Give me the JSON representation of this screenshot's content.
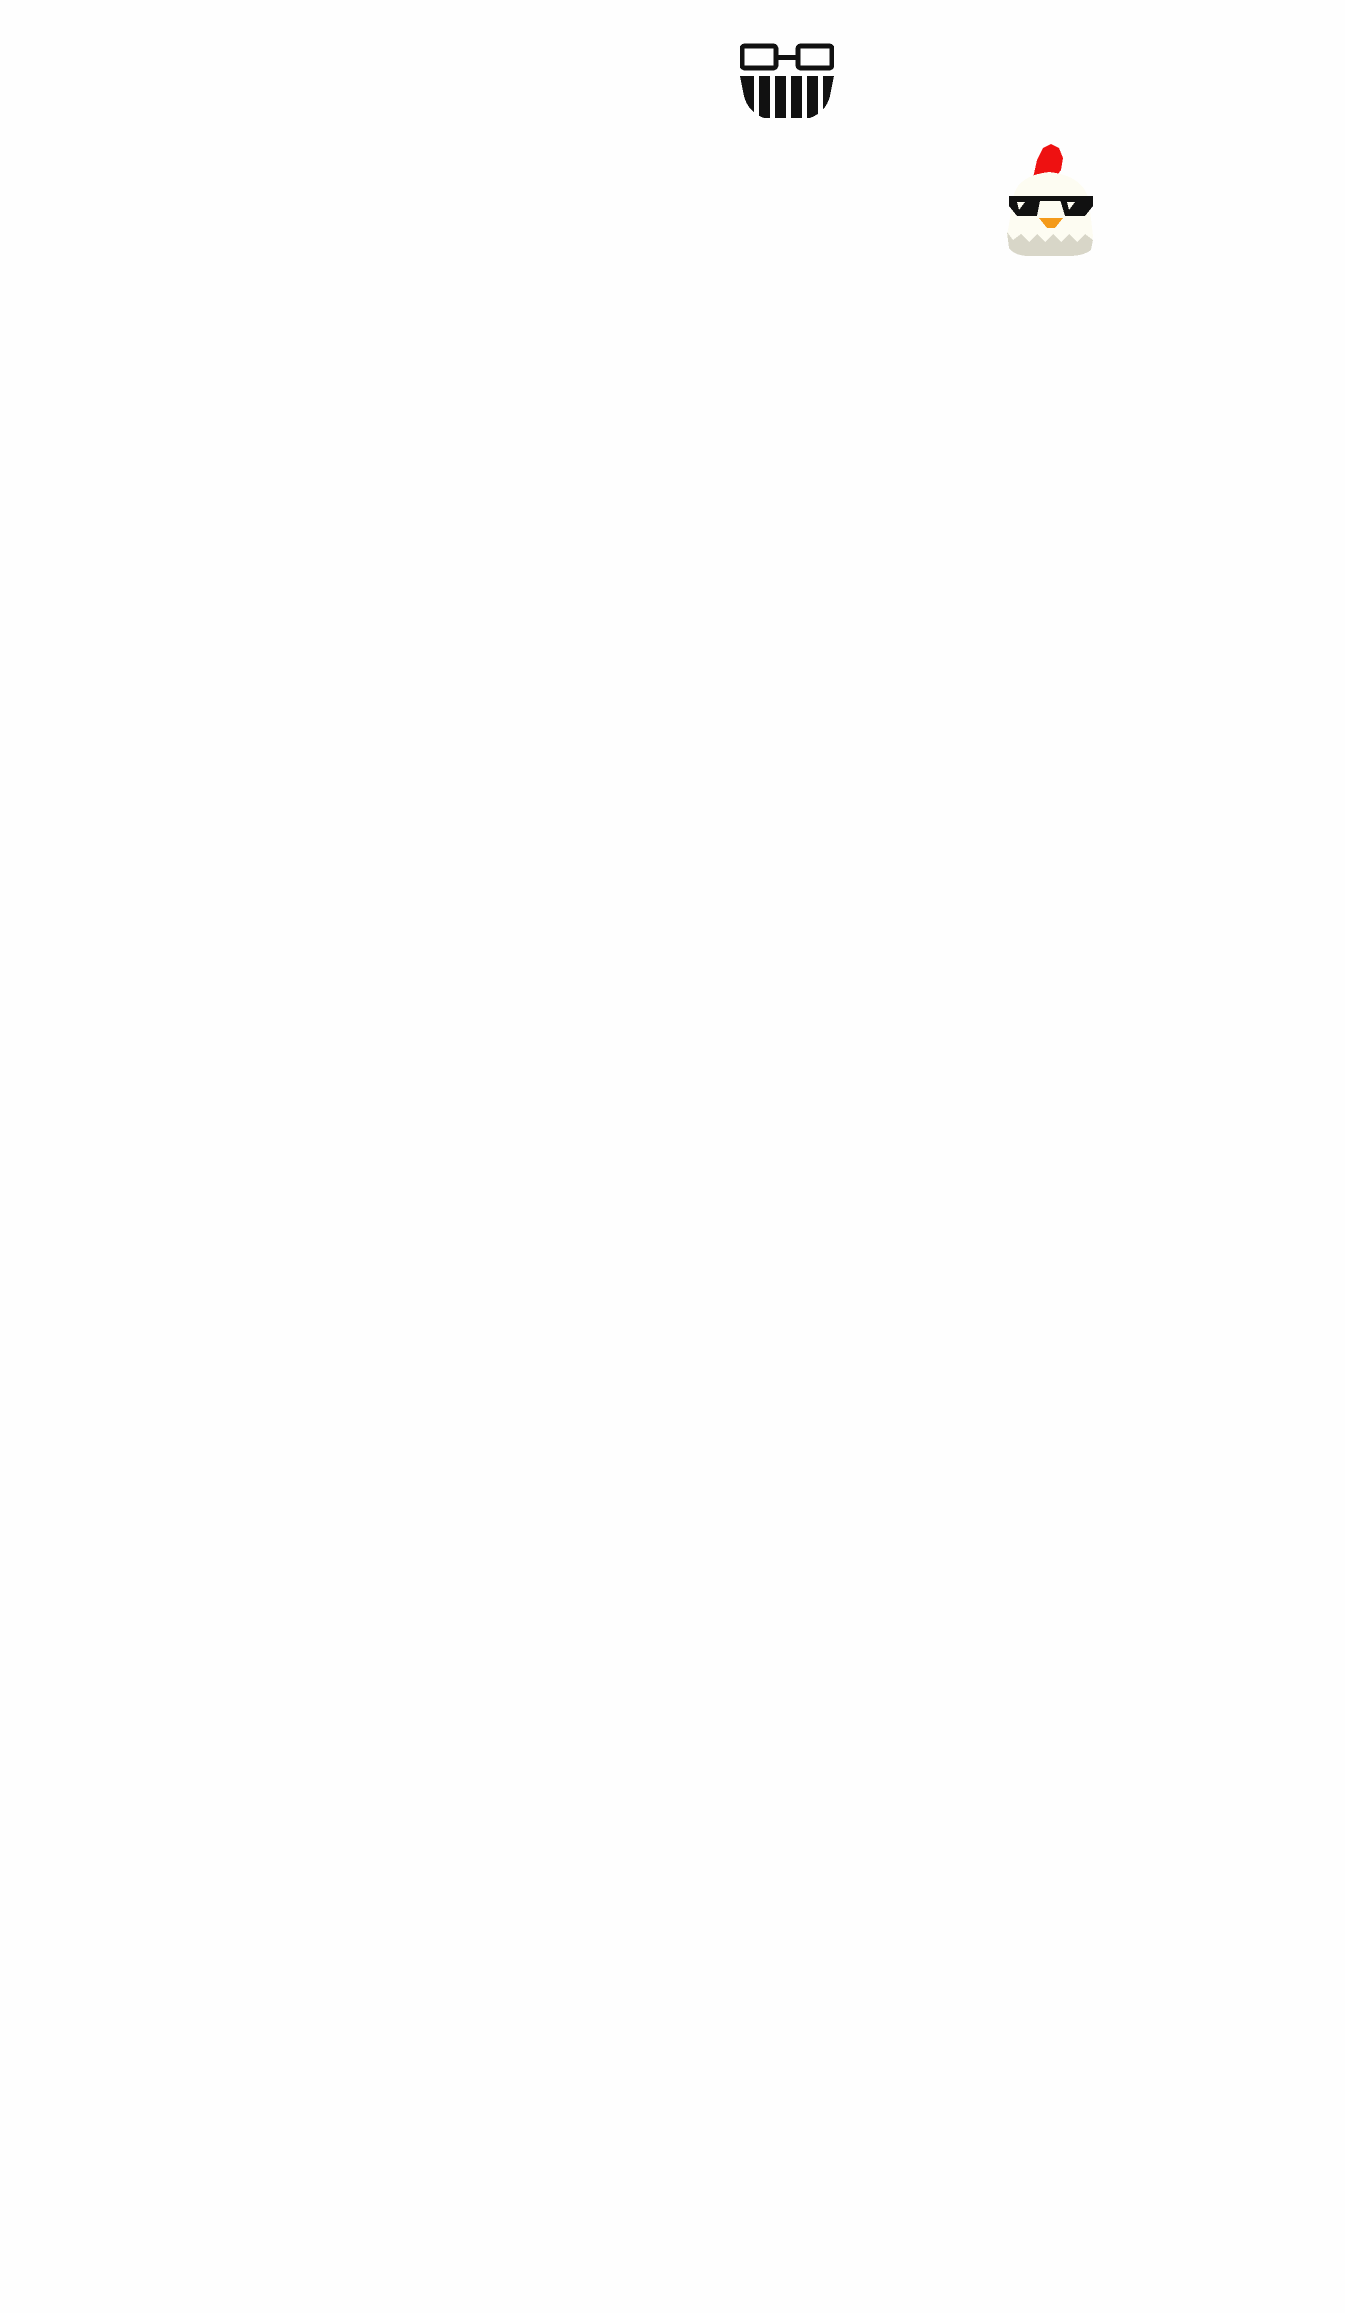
{
  "header": {
    "logo_icon": "glasses-barcode-logo-icon"
  },
  "mascot": {
    "icon": "chicken-with-sunglasses-icon",
    "colors": {
      "comb": "#ee1111",
      "body": "#fdfcf2",
      "shadow": "#d8d6c8",
      "beak": "#f49a1a",
      "glasses": "#111111"
    }
  }
}
